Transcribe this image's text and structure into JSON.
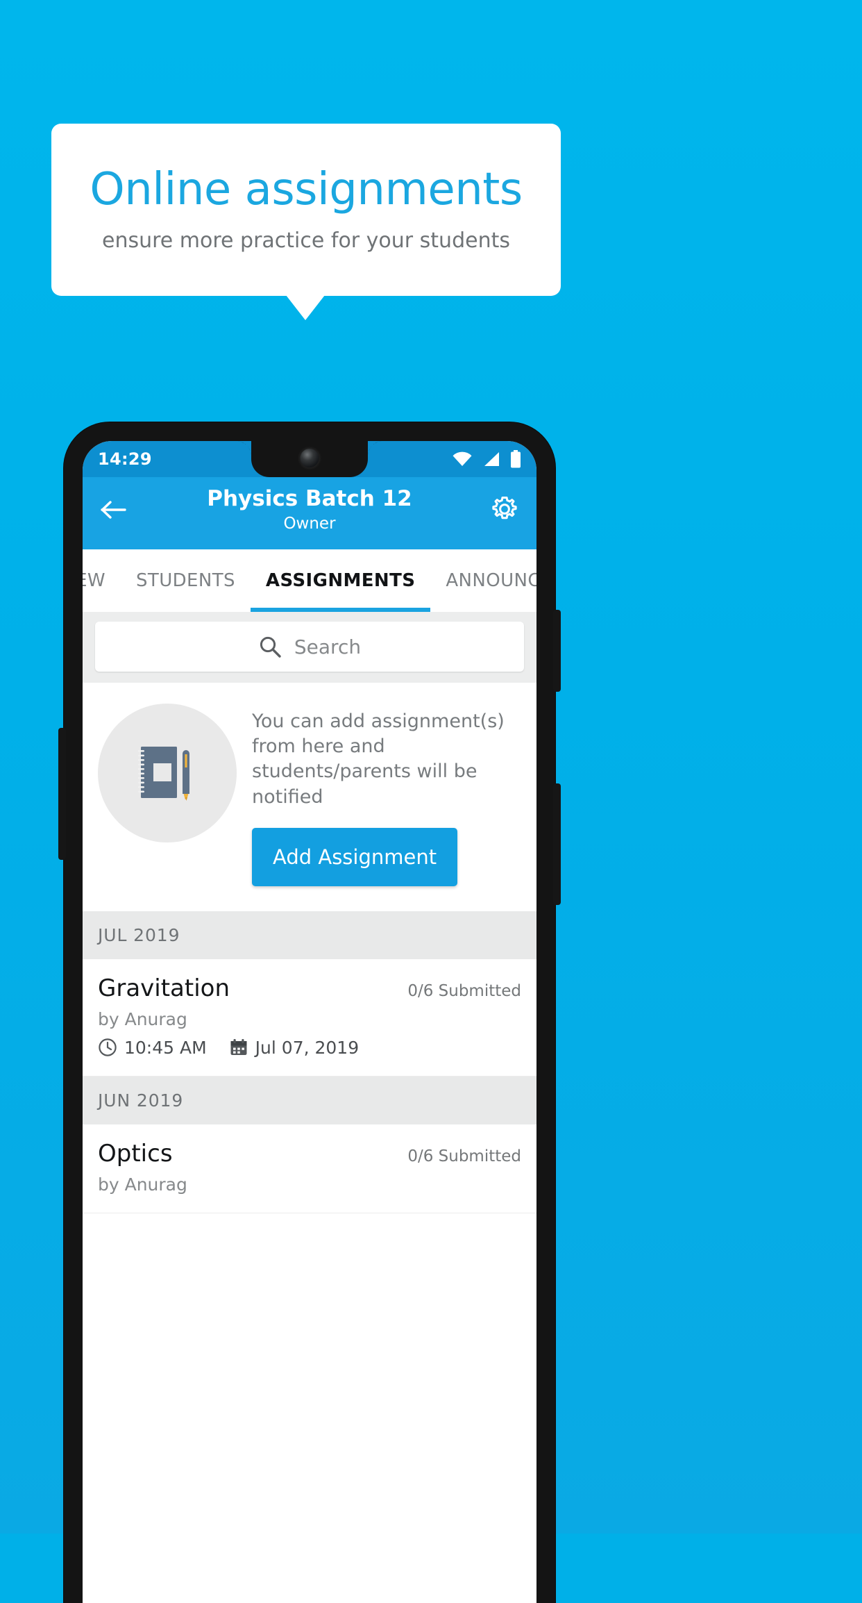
{
  "promo": {
    "headline": "Online assignments",
    "subhead": "ensure more practice for your students",
    "accent_color": "#1ba7e0",
    "background_color": "#00b0e9"
  },
  "phone": {
    "status_bar": {
      "time": "14:29",
      "icons": [
        "wifi-icon",
        "cellular-signal-icon",
        "battery-icon"
      ]
    },
    "app_bar": {
      "back_icon": "arrow-left-icon",
      "title": "Physics Batch 12",
      "subtitle": "Owner",
      "settings_icon": "gear-icon"
    },
    "tabs": [
      {
        "label": "IEW",
        "active": false
      },
      {
        "label": "STUDENTS",
        "active": false
      },
      {
        "label": "ASSIGNMENTS",
        "active": true
      },
      {
        "label": "ANNOUNCEMENTS",
        "active": false
      }
    ],
    "search": {
      "icon": "search-icon",
      "placeholder": "Search",
      "value": ""
    },
    "empty_state": {
      "illustration": "notebook-and-pen-icon",
      "message": "You can add assignment(s) from here and students/parents will be notified",
      "button_label": "Add Assignment"
    },
    "groups": [
      {
        "month_label": "JUL 2019",
        "items": [
          {
            "title": "Gravitation",
            "submitted": "0/6 Submitted",
            "author": "by Anurag",
            "time_icon": "clock-icon",
            "time": "10:45 AM",
            "date_icon": "calendar-icon",
            "date": "Jul 07, 2019"
          }
        ]
      },
      {
        "month_label": "JUN 2019",
        "items": [
          {
            "title": "Optics",
            "submitted": "0/6 Submitted",
            "author": "by Anurag",
            "time_icon": "clock-icon",
            "time": "",
            "date_icon": "calendar-icon",
            "date": ""
          }
        ]
      }
    ]
  }
}
